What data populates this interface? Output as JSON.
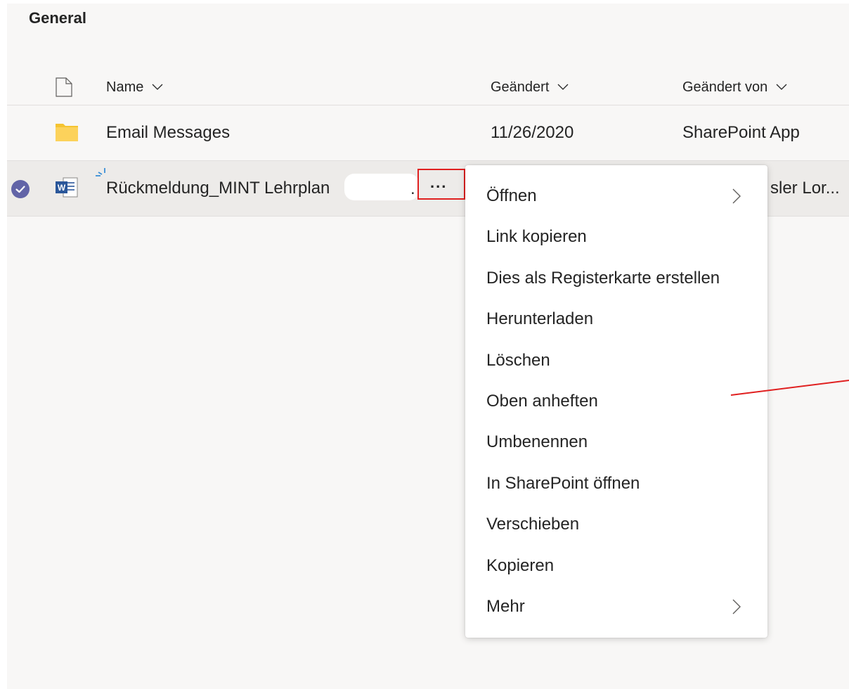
{
  "channel": {
    "title": "General"
  },
  "columns": {
    "name": "Name",
    "modified": "Geändert",
    "modified_by": "Geändert von"
  },
  "rows": [
    {
      "type": "folder",
      "name": "Email Messages",
      "modified": "11/26/2020",
      "modified_by": "SharePoint App"
    },
    {
      "type": "word-document",
      "name": "Rückmeldung_MINT Lehrplan",
      "modified_by": "sler Lor..."
    }
  ],
  "more_button": {
    "label": "..."
  },
  "context_menu": {
    "items": [
      {
        "label": "Öffnen",
        "submenu": true
      },
      {
        "label": "Link kopieren",
        "submenu": false
      },
      {
        "label": "Dies als Registerkarte erstellen",
        "submenu": false
      },
      {
        "label": "Herunterladen",
        "submenu": false
      },
      {
        "label": "Löschen",
        "submenu": false
      },
      {
        "label": "Oben anheften",
        "submenu": false
      },
      {
        "label": "Umbenennen",
        "submenu": false
      },
      {
        "label": "In SharePoint öffnen",
        "submenu": false
      },
      {
        "label": "Verschieben",
        "submenu": false
      },
      {
        "label": "Kopieren",
        "submenu": false
      },
      {
        "label": "Mehr",
        "submenu": true
      }
    ]
  },
  "colors": {
    "accent": "#6264a7",
    "highlight": "#e02020",
    "folder": "#f5c431",
    "word": "#2b579a"
  }
}
